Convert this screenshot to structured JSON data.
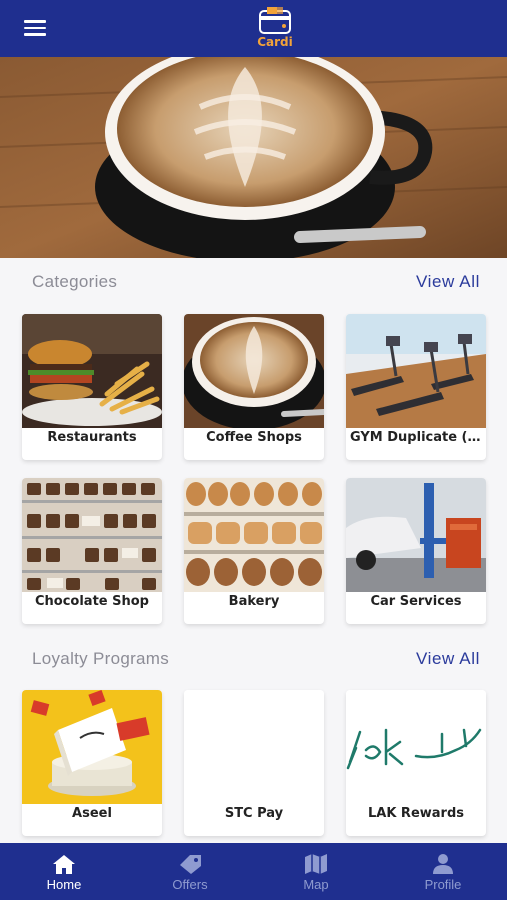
{
  "app": {
    "logo_text": "Cardi"
  },
  "hero": {
    "slide_count": 4,
    "active_slide": 1
  },
  "categories": {
    "title": "Categories",
    "view_all": "View All",
    "items": [
      {
        "label": "Restaurants"
      },
      {
        "label": "Coffee Shops"
      },
      {
        "label": "GYM Duplicate (d..."
      },
      {
        "label": "Chocolate Shop"
      },
      {
        "label": "Bakery"
      },
      {
        "label": "Car Services"
      }
    ]
  },
  "loyalty": {
    "title": "Loyalty Programs",
    "view_all": "View All",
    "items": [
      {
        "label": "Aseel"
      },
      {
        "label": "STC Pay"
      },
      {
        "label": "LAK Rewards"
      }
    ]
  },
  "nav": {
    "items": [
      {
        "label": "Home",
        "icon": "home-icon",
        "active": true
      },
      {
        "label": "Offers",
        "icon": "tag-icon",
        "active": false
      },
      {
        "label": "Map",
        "icon": "map-icon",
        "active": false
      },
      {
        "label": "Profile",
        "icon": "user-icon",
        "active": false
      }
    ]
  },
  "colors": {
    "brand": "#1f2f8f",
    "accent": "#f2a33a",
    "link": "#2b3b9c"
  }
}
